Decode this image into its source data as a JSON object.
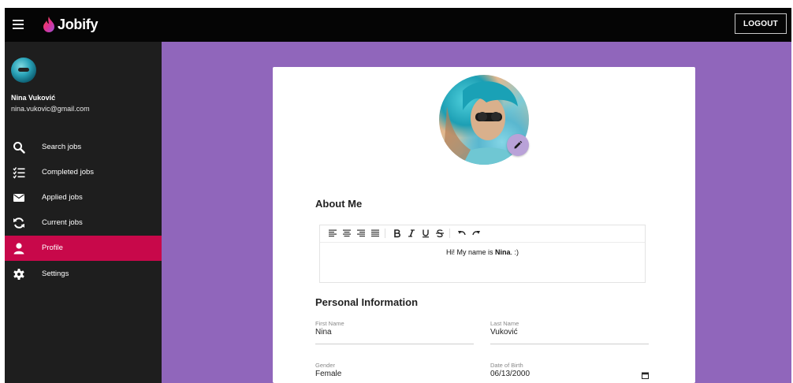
{
  "app": {
    "name": "Jobify"
  },
  "header": {
    "logout_label": "LOGOUT"
  },
  "user": {
    "name": "Nina Vuković",
    "email": "nina.vukovic@gmail.com"
  },
  "sidebar": {
    "items": [
      {
        "label": "Search jobs",
        "icon": "search-icon"
      },
      {
        "label": "Completed jobs",
        "icon": "checklist-icon"
      },
      {
        "label": "Applied jobs",
        "icon": "envelope-icon"
      },
      {
        "label": "Current jobs",
        "icon": "refresh-icon"
      },
      {
        "label": "Profile",
        "icon": "person-icon",
        "active": true
      },
      {
        "label": "Settings",
        "icon": "gear-icon"
      }
    ]
  },
  "about": {
    "title": "About Me",
    "content_prefix": "Hi! My name is ",
    "content_bold": "Nina",
    "content_suffix": ". :)"
  },
  "personal": {
    "title": "Personal Information",
    "first_name": {
      "label": "First Name",
      "value": "Nina"
    },
    "last_name": {
      "label": "Last Name",
      "value": "Vuković"
    },
    "gender": {
      "label": "Gender",
      "value": "Female"
    },
    "dob": {
      "label": "Date of Birth",
      "value": "06/13/2000"
    }
  },
  "colors": {
    "topbar": "#050505",
    "sidebar": "#1e1e1e",
    "active_item": "#c8084a",
    "background": "#9066bb",
    "edit_button": "#b9a2d8"
  }
}
